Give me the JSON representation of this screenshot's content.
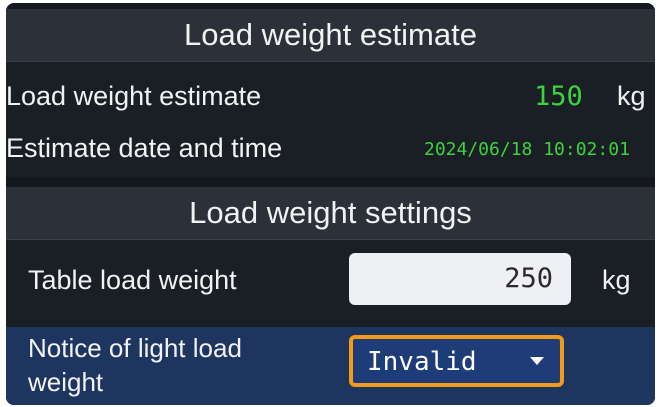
{
  "estimate_panel": {
    "title": "Load weight estimate",
    "weight_label": "Load weight estimate",
    "weight_value": "150",
    "weight_unit": "kg",
    "datetime_label": "Estimate date and time",
    "datetime_value": "2024/06/18 10:02:01"
  },
  "settings_panel": {
    "title": "Load weight settings",
    "table_load_label": "Table load weight",
    "table_load_value": "250",
    "table_load_unit": "kg",
    "notice_label_line1": "Notice of light load",
    "notice_label_line2": "weight",
    "notice_selected": "Invalid"
  },
  "colors": {
    "value_green": "#3ed13e",
    "selected_row": "#1e3560",
    "dropdown_border": "#f39a17"
  },
  "icons": {
    "dropdown": "chevron-down-icon"
  }
}
